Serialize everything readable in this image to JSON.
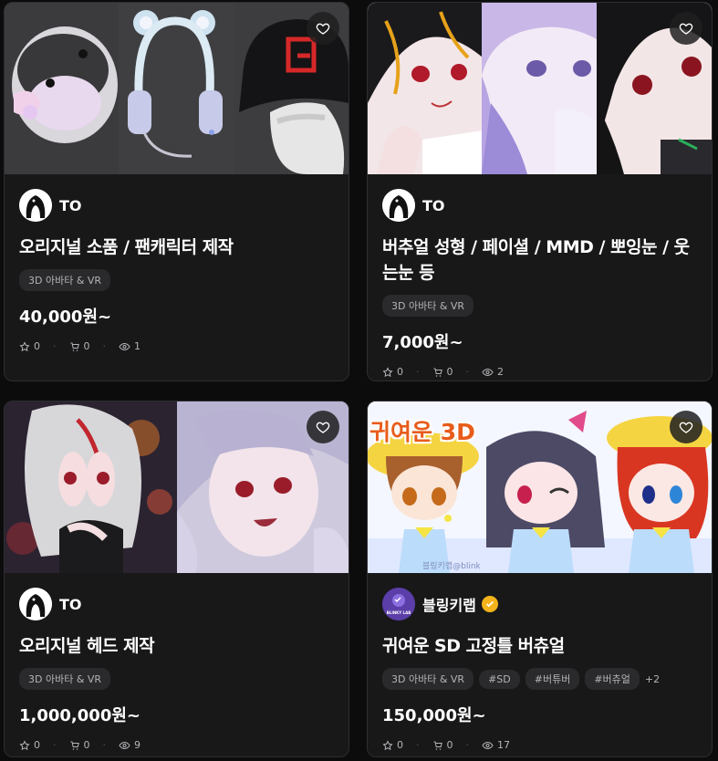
{
  "colors": {
    "background": "#0c0c0d",
    "card": "#181819",
    "tag_bg": "#2a2a2d",
    "verified": "#f3b41b",
    "blinky_avatar": "#5b3ea8"
  },
  "cards": [
    {
      "thumbnail_desc": [
        "ghost-plush-helmet",
        "bear-ear-headphones",
        "black-cap-with-red-G"
      ],
      "seller": "TO",
      "title": "오리지널 소품 / 팬캐릭터 제작",
      "tags": [
        "3D 아바타 & VR"
      ],
      "price": "40,000원~",
      "likes": "0",
      "cart": "0",
      "views": "1"
    },
    {
      "thumbnail_desc": [
        "anime-avatar-black-hair",
        "anime-avatar-purple-hair",
        "anime-avatar-red-eyes"
      ],
      "seller": "TO",
      "title": "버추얼 성형 / 페이셜 / MMD / 뽀잉눈 / 웃는눈 등",
      "tags": [
        "3D 아바타 & VR"
      ],
      "price": "7,000원~",
      "likes": "0",
      "cart": "0",
      "views": "2"
    },
    {
      "thumbnail_desc": [
        "anime-avatar-silver-hair",
        "anime-avatar-lavender-hair"
      ],
      "seller": "TO",
      "title": "오리지널 헤드 제작",
      "tags": [
        "3D 아바타 & VR"
      ],
      "price": "1,000,000원~",
      "likes": "0",
      "cart": "0",
      "views": "9"
    },
    {
      "thumbnail_banner": "귀여운 3D",
      "thumbnail_watermark": "블링키랩@blink",
      "seller": "블링키랩",
      "seller_logo_text": "BLINKY LAB",
      "title": "귀여운 SD 고정틀 버츄얼",
      "tags": [
        "3D 아바타 & VR",
        "#SD",
        "#버튜버",
        "#버츄얼"
      ],
      "tags_more": "+2",
      "price": "150,000원~",
      "likes": "0",
      "cart": "0",
      "views": "17"
    }
  ]
}
